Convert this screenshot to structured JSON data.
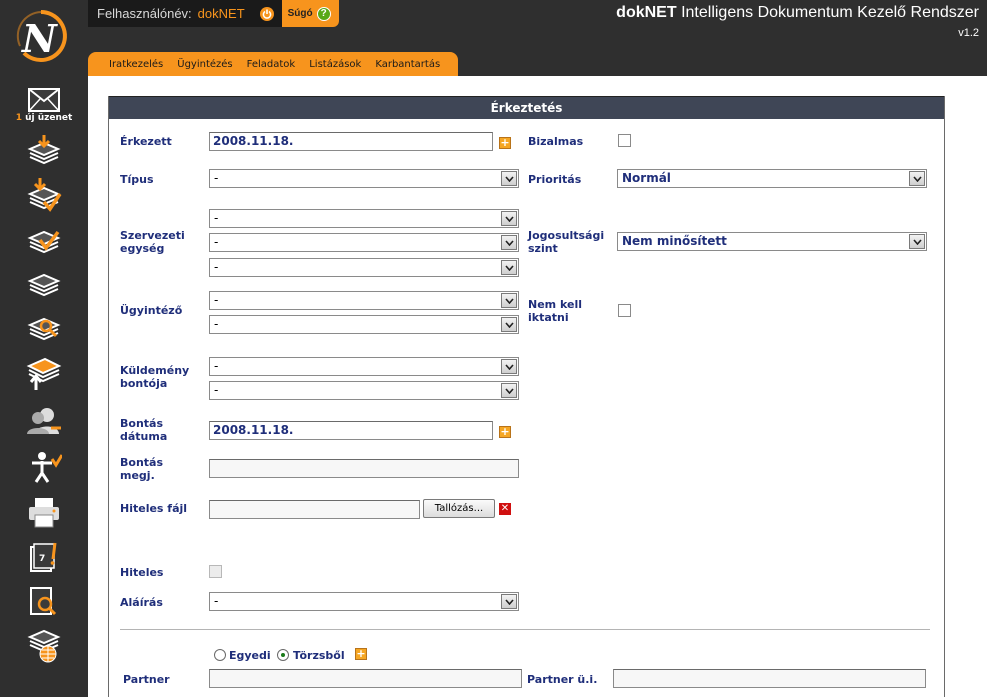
{
  "header": {
    "user_label": "Felhasználónév:",
    "username": "dokNET",
    "help_label": "Súgó",
    "app_name": "dokNET",
    "app_subtitle": " Intelligens Dokumentum Kezelő Rendszer",
    "version": "v1.2"
  },
  "sidebar": {
    "message_count": "1",
    "message_label": " új üzenet"
  },
  "menu": [
    "Iratkezelés",
    "Ügyintézés",
    "Feladatok",
    "Listázások",
    "Karbantartás"
  ],
  "form": {
    "title": "Érkeztetés",
    "erkezett": {
      "label": "Érkezett",
      "value": "2008.11.18."
    },
    "tipus": {
      "label": "Típus",
      "value": "-"
    },
    "szervezeti": {
      "label1": "Szervezeti",
      "label2": "egység",
      "values": [
        "-",
        "-",
        "-"
      ]
    },
    "ugyintezo": {
      "label": "Ügyintéző",
      "values": [
        "-",
        "-"
      ]
    },
    "kuldemeny": {
      "label1": "Küldemény",
      "label2": "bontója",
      "values": [
        "-",
        "-"
      ]
    },
    "bontas_datuma": {
      "label1": "Bontás",
      "label2": "dátuma",
      "value": "2008.11.18."
    },
    "bontas_megj": {
      "label1": "Bontás",
      "label2": "megj.",
      "value": ""
    },
    "hiteles_fajl": {
      "label": "Hiteles fájl",
      "value": "",
      "browse_label": "Tallózás..."
    },
    "hiteles": {
      "label": "Hiteles"
    },
    "alairas": {
      "label": "Aláírás",
      "value": "-"
    },
    "bizalmas": {
      "label": "Bizalmas"
    },
    "prioritas": {
      "label": "Prioritás",
      "value": "Normál"
    },
    "jogosultsagi": {
      "label1": "Jogosultsági",
      "label2": "szint",
      "value": "Nem minősített"
    },
    "nem_kell": {
      "label1": "Nem kell",
      "label2": "iktatni"
    },
    "partner_source": {
      "egyedi": "Egyedi",
      "torzsbol": "Törzsből"
    },
    "partner": {
      "label": "Partner",
      "value": ""
    },
    "partner_ui": {
      "label": "Partner ü.i.",
      "value": ""
    }
  },
  "colors": {
    "accent": "#f7941d",
    "dark": "#2f2f2f",
    "label_blue": "#1f2e7a",
    "panel_title_bg": "#3f4656"
  }
}
